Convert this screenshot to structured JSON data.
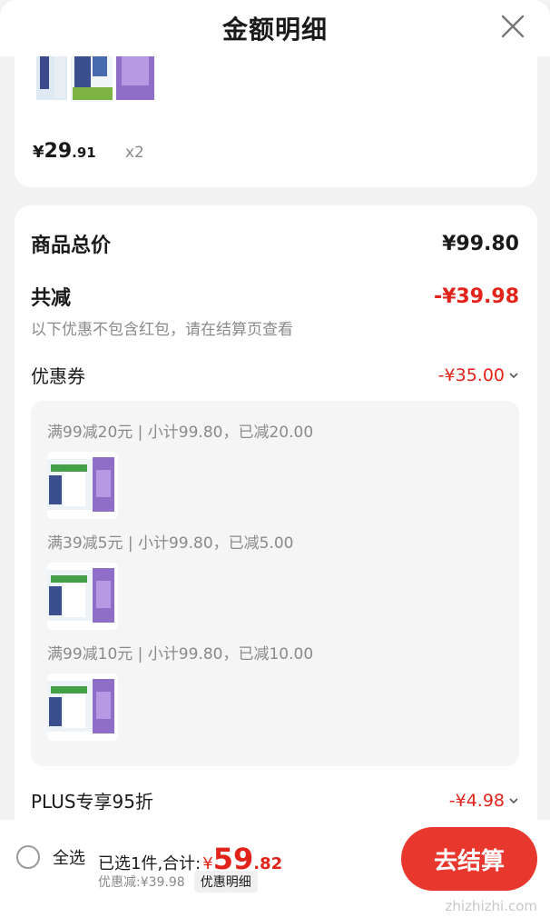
{
  "header": {
    "title": "金额明细"
  },
  "top_item": {
    "price_symbol": "¥",
    "price_int": "29",
    "price_dec": ".91",
    "qty": "x2"
  },
  "summary": {
    "total_label": "商品总价",
    "total_value": "¥99.80",
    "reduce_label": "共减",
    "reduce_value": "-¥39.98",
    "note": "以下优惠不包含红包，请在结算页查看",
    "coupon_label": "优惠券",
    "coupon_value": "-¥35.00",
    "plus_label": "PLUS专享95折",
    "plus_value": "-¥4.98"
  },
  "coupons": [
    {
      "text": "满99减20元 | 小计99.80，已减20.00"
    },
    {
      "text": "满39减5元 | 小计99.80，已减5.00"
    },
    {
      "text": "满99减10元 | 小计99.80，已减10.00"
    }
  ],
  "bottom": {
    "select_all": "全选",
    "selected_text": "已选1件,合计:",
    "total_symbol": "¥",
    "total_int": "59",
    "total_dec": ".82",
    "discount": "优惠减:¥39.98",
    "detail_chip": "优惠明细",
    "checkout": "去结算"
  },
  "watermark": {
    "url": "zhizhizhi.com"
  },
  "colors": {
    "accent_red": "#e2231a",
    "button_red": "#e8372c"
  },
  "icons": {
    "close": "close-icon",
    "chevron": "chevron-down-icon",
    "radio": "radio-unchecked-icon"
  }
}
